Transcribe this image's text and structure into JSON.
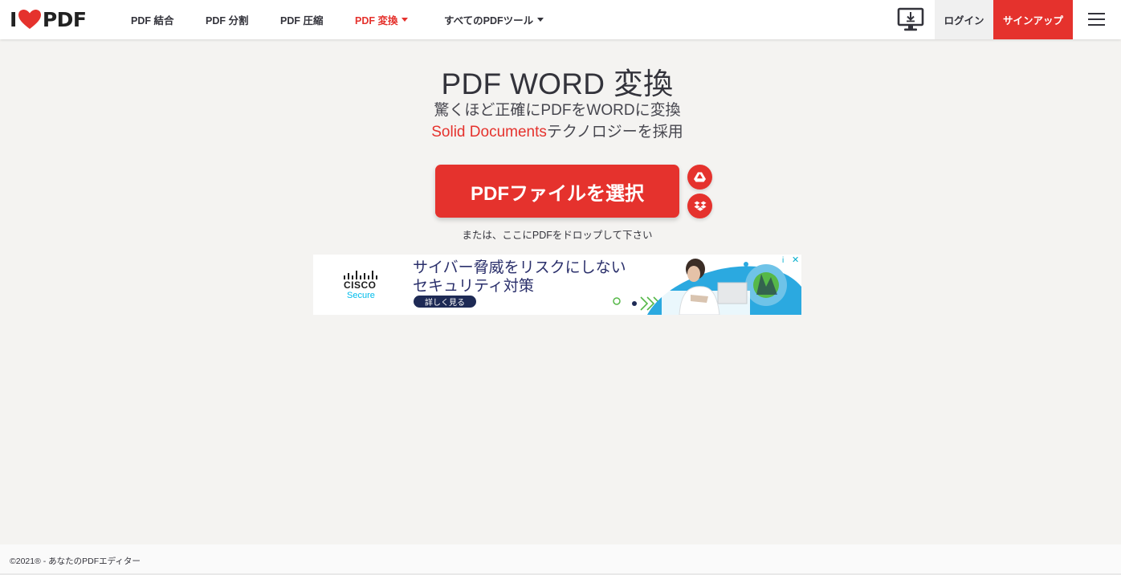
{
  "brand": {
    "logo_left": "I",
    "logo_right": "PDF",
    "accent_color": "#e5322d"
  },
  "nav": {
    "items": [
      {
        "label": "PDF 結合"
      },
      {
        "label": "PDF 分割"
      },
      {
        "label": "PDF 圧縮"
      },
      {
        "label": "PDF 変換"
      },
      {
        "label": "すべてのPDFツール"
      }
    ],
    "login": "ログイン",
    "signup": "サインアップ"
  },
  "main": {
    "title": "PDF WORD 変換",
    "subtitle_line1": "驚くほど正確にPDFをWORDに変換",
    "subtitle_line2_highlight": "Solid Documents",
    "subtitle_line2_rest": "テクノロジーを採用",
    "select_button": "PDFファイルを選択",
    "drop_text": "または、ここにPDFをドロップして下さい"
  },
  "ad": {
    "brand_name": "CISCO",
    "brand_sub": "Secure",
    "headline_line1": "サイバー脅威をリスクにしない",
    "headline_line2": "セキュリティ対策",
    "cta": "詳しく見る",
    "info_icon": "i",
    "close_icon": "✕"
  },
  "footer": {
    "text": "©2021® - あなたのPDFエディター"
  }
}
